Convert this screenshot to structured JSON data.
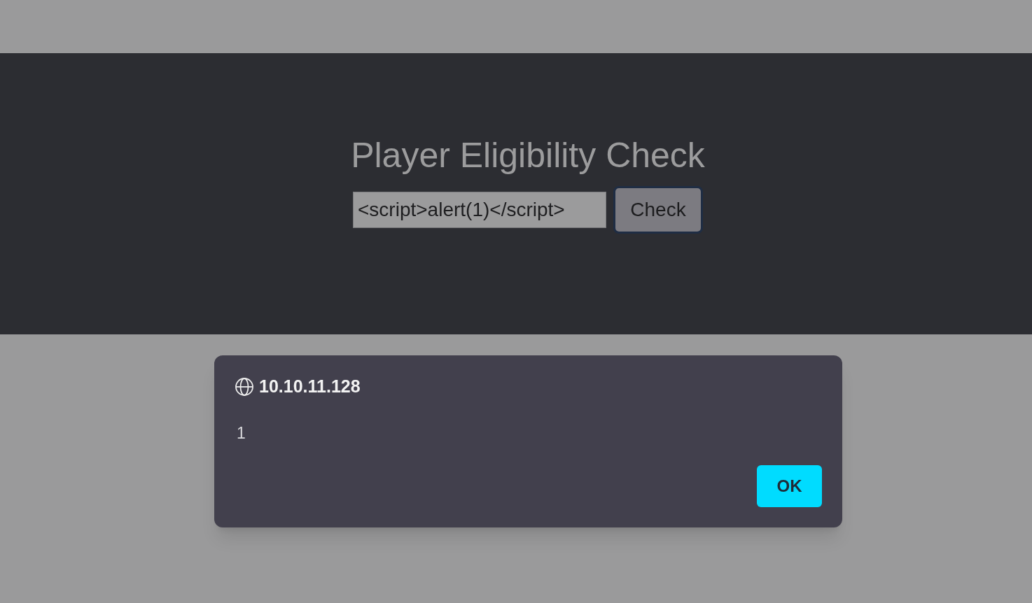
{
  "page": {
    "title": "Player Eligibility Check",
    "input": {
      "value": "<script>alert(1)</script>"
    },
    "button": {
      "label": "Check",
      "focused": true
    }
  },
  "alert": {
    "origin": "10.10.11.128",
    "message": "1",
    "buttons": [
      "OK"
    ]
  }
}
